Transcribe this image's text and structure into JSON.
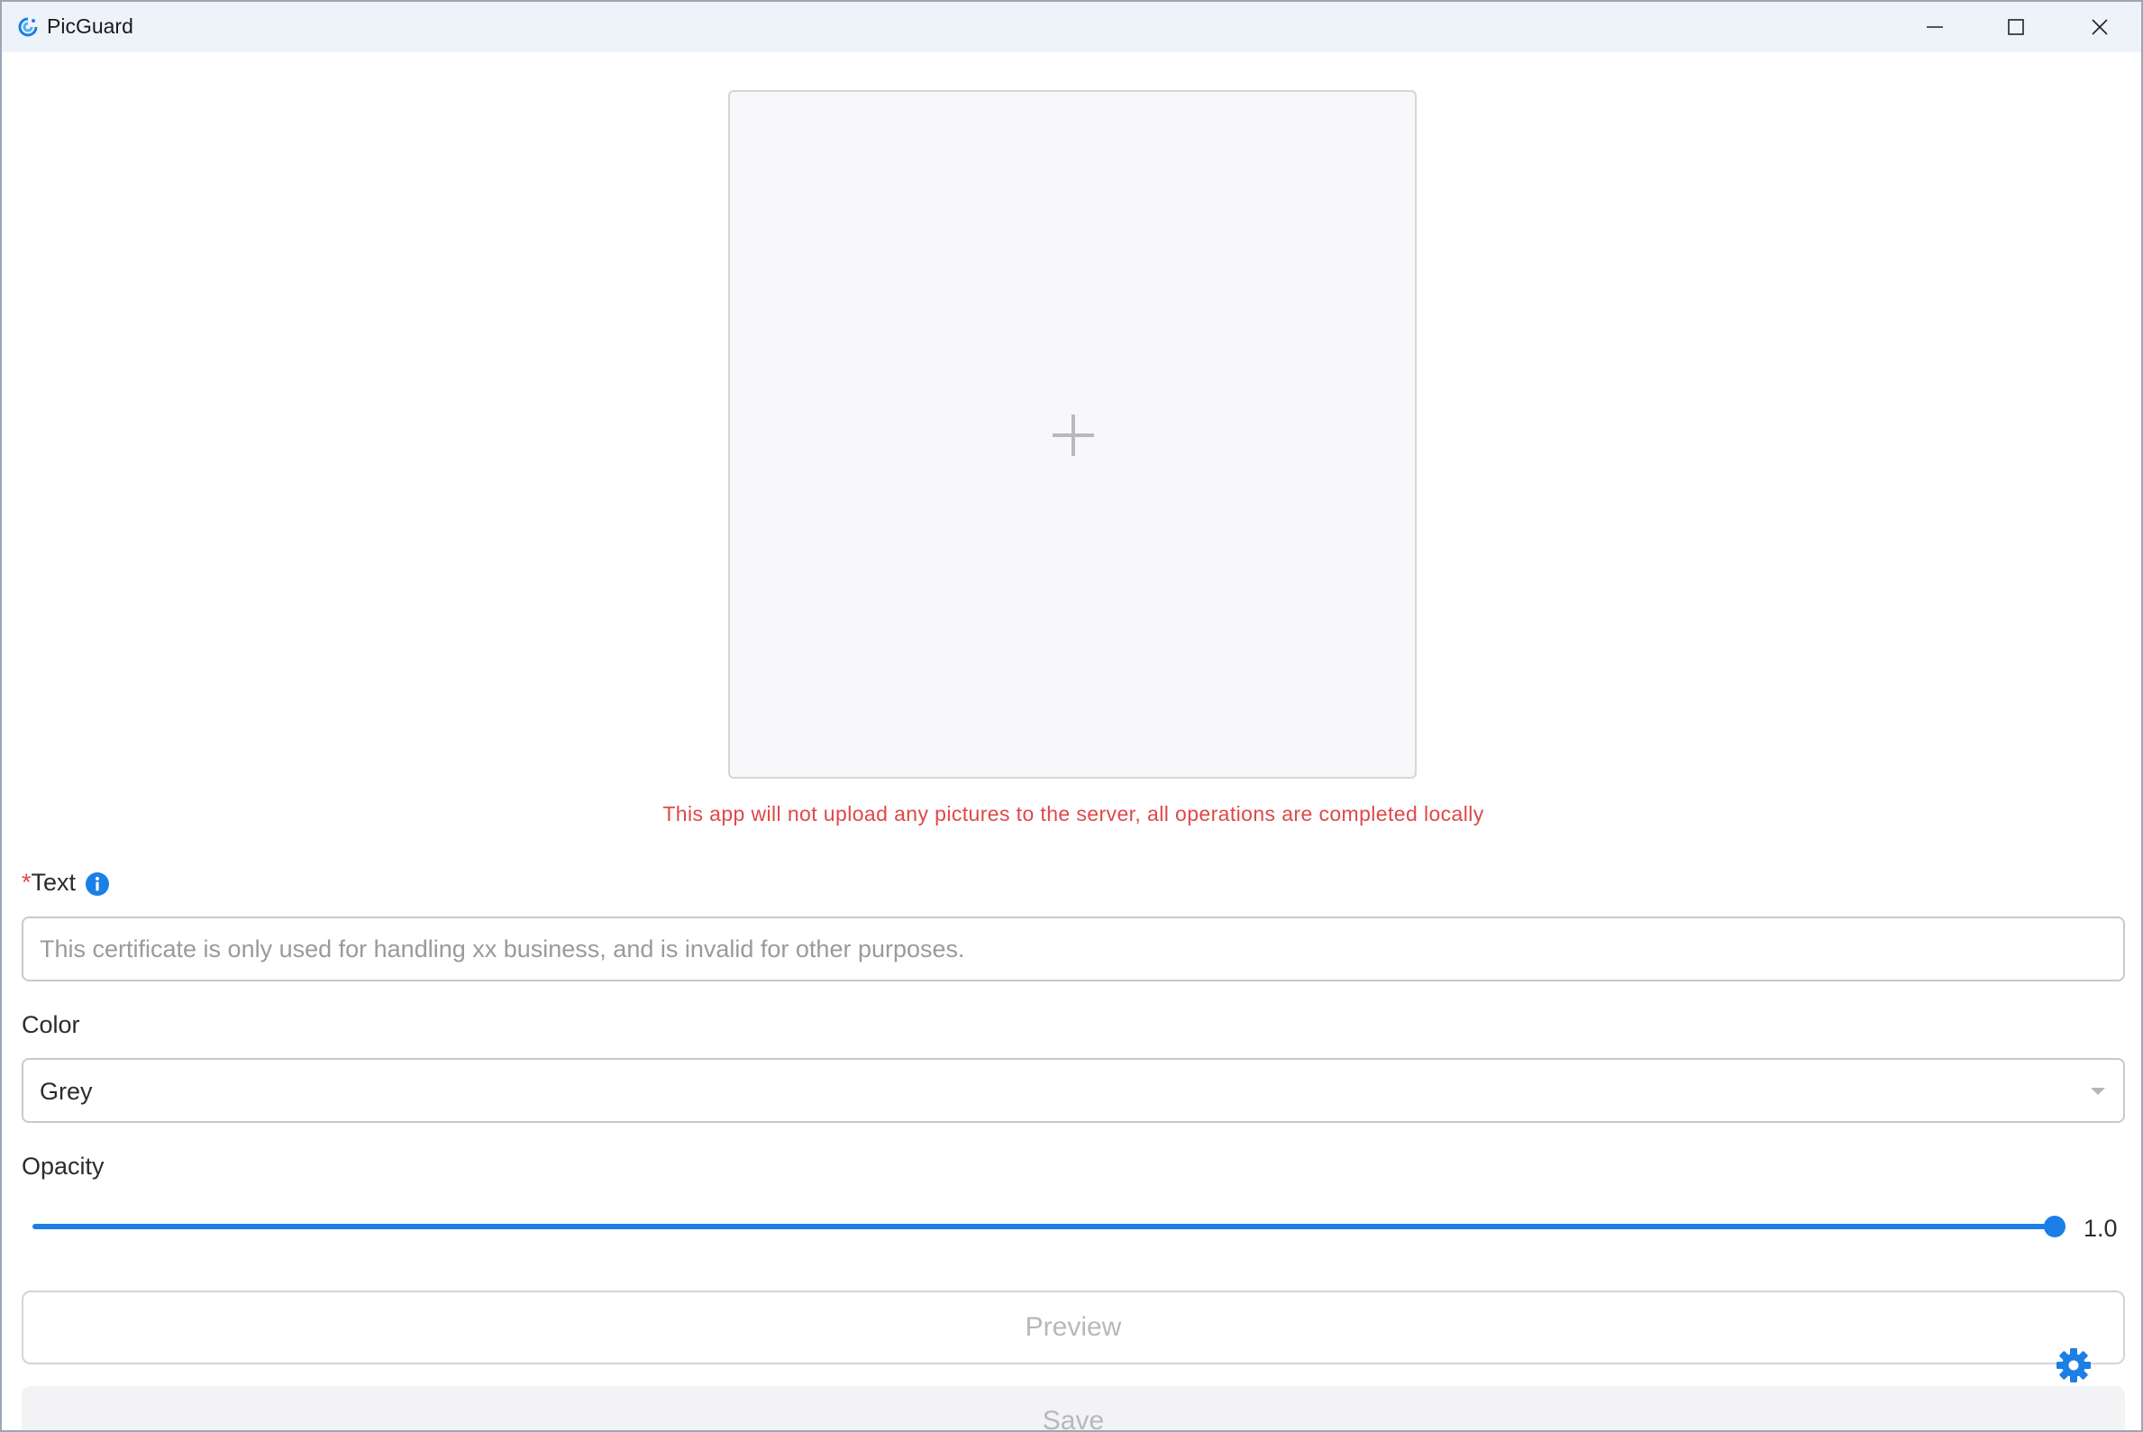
{
  "window": {
    "title": "PicGuard",
    "controls": {
      "minimize": "minimize-icon",
      "maximize": "maximize-icon",
      "close": "close-icon"
    }
  },
  "upload": {
    "icon": "plus-icon",
    "notice": "This app will not upload any pictures to the server, all operations are completed locally"
  },
  "form": {
    "text": {
      "required_mark": "*",
      "label": "Text",
      "info_icon": "info-icon",
      "value": "",
      "placeholder": "This certificate is only used for handling xx business, and is invalid for other purposes."
    },
    "color": {
      "label": "Color",
      "selected": "Grey"
    },
    "opacity": {
      "label": "Opacity",
      "value": 1.0,
      "value_text": "1.0",
      "min": 0,
      "max": 1
    }
  },
  "buttons": {
    "preview": "Preview",
    "save": "Save"
  },
  "floating": {
    "settings_icon": "gear-icon"
  },
  "colors": {
    "accent": "#1b7fe6",
    "notice": "#e04848",
    "titlebar": "#eef3f9"
  }
}
